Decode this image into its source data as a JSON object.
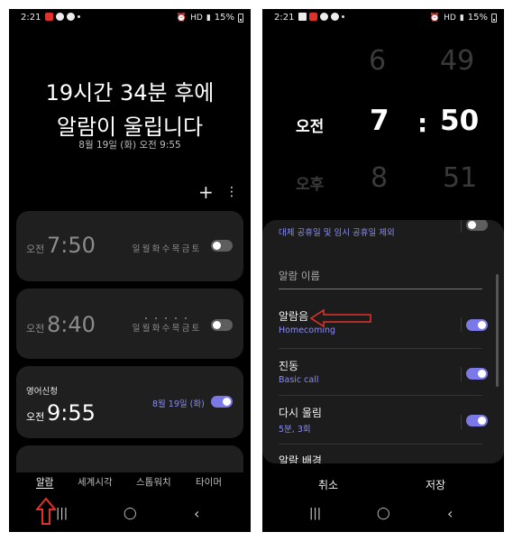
{
  "left": {
    "status": {
      "time": "2:21",
      "battery": "15%",
      "signal": "HD"
    },
    "headline_line1": "19시간 34분 후에",
    "headline_line2": "알람이 울립니다",
    "next_alarm_text": "8월 19일 (화) 오전 9:55",
    "toolbar": {
      "add_glyph": "+",
      "more_glyph": "⋮"
    },
    "alarms": [
      {
        "ampm": "오전",
        "time": "7:50",
        "days": [
          "일",
          "월",
          "화",
          "수",
          "목",
          "금",
          "토"
        ],
        "enabled": false
      },
      {
        "ampm": "오전",
        "time": "8:40",
        "days": [
          "일",
          "월",
          "화",
          "수",
          "목",
          "금",
          "토"
        ],
        "enabled": false
      },
      {
        "label": "영어신청",
        "ampm": "오전",
        "time": "9:55",
        "date": "8월 19일 (화)",
        "enabled": true
      }
    ],
    "tabs": [
      "알람",
      "세계시각",
      "스톱워치",
      "타이머"
    ],
    "active_tab": "알람",
    "nav": {
      "recents": "|||",
      "home": "◯",
      "back": "‹"
    }
  },
  "right": {
    "status": {
      "time": "2:21",
      "battery": "15%",
      "signal": "HD"
    },
    "picker": {
      "ampm_selected": "오전",
      "ampm_below": "오후",
      "hour_above": "6",
      "hour_selected": "7",
      "hour_below": "8",
      "minute_above": "49",
      "minute_selected": "50",
      "minute_below": "51",
      "colon": ":"
    },
    "settings": {
      "holiday_sub": "대체 공휴일 및 임시 공휴일 제외",
      "name_placeholder": "알람 이름",
      "sound_title": "알람음",
      "sound_sub": "Homecoming",
      "sound_enabled": true,
      "vibration_title": "진동",
      "vibration_sub": "Basic call",
      "vibration_enabled": true,
      "snooze_title": "다시 울림",
      "snooze_sub": "5분, 3회",
      "snooze_enabled": true,
      "background_title": "알람 배경"
    },
    "buttons": {
      "cancel": "취소",
      "save": "저장"
    },
    "nav": {
      "recents": "|||",
      "home": "◯",
      "back": "‹"
    }
  },
  "colors": {
    "accent": "#7b79e8",
    "annotation_arrow": "#e0312b",
    "background": "#000000",
    "card": "#1f1f1f"
  }
}
